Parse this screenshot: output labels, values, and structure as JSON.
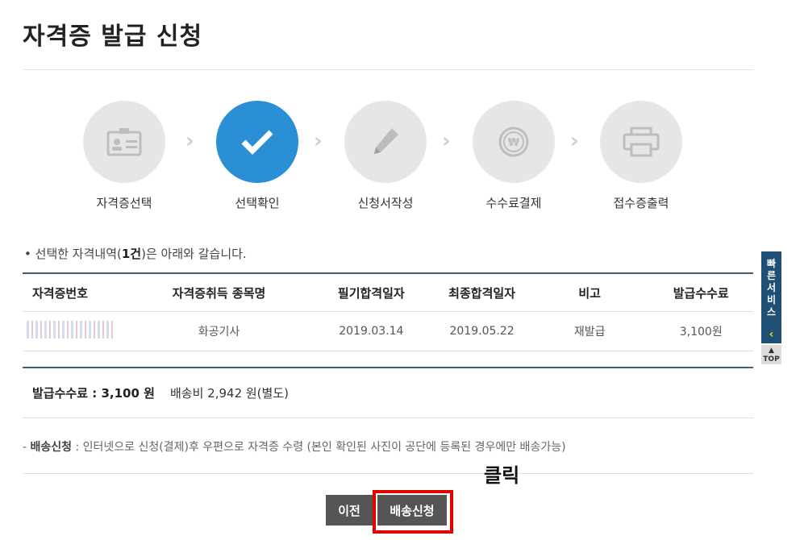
{
  "page": {
    "title": "자격증 발급 신청"
  },
  "steps": [
    {
      "label": "자격증선택",
      "icon": "id-card-icon",
      "active": false
    },
    {
      "label": "선택확인",
      "icon": "checkmark-icon",
      "active": true
    },
    {
      "label": "신청서작성",
      "icon": "pencil-icon",
      "active": false
    },
    {
      "label": "수수료결제",
      "icon": "won-coin-icon",
      "active": false
    },
    {
      "label": "접수증출력",
      "icon": "printer-icon",
      "active": false
    }
  ],
  "notice": {
    "prefix": "선택한 자격내역(",
    "count": "1건",
    "suffix": ")은 아래와 갈습니다."
  },
  "table": {
    "headers": [
      "자격증번호",
      "자격증취득 종목명",
      "필기합격일자",
      "최종합격일자",
      "비고",
      "발급수수료"
    ],
    "rows": [
      {
        "number": "",
        "name": "화공기사",
        "written_date": "2019.03.14",
        "final_date": "2019.05.22",
        "remark": "재발급",
        "fee": "3,100원"
      }
    ]
  },
  "fees": {
    "label": "발급수수료 : 3,100 원",
    "shipping": "배송비 2,942 원(별도)"
  },
  "delivery": {
    "prefix": "- ",
    "title": "배송신청",
    "text": " : 인터넷으로 신청(결제)후 우편으로 자격증 수령 (본인 확인된 사진이 공단에 등록된 경우에만 배송가능)"
  },
  "annotation": {
    "click_text": "클릭"
  },
  "buttons": {
    "prev": "이전",
    "apply": "배송신청"
  },
  "quick_service": {
    "label": "빠른서비스",
    "arrow": "‹",
    "top": "TOP"
  },
  "colors": {
    "accent": "#2b8fd6",
    "header_line": "#3a5f7a",
    "highlight": "#e00000"
  }
}
